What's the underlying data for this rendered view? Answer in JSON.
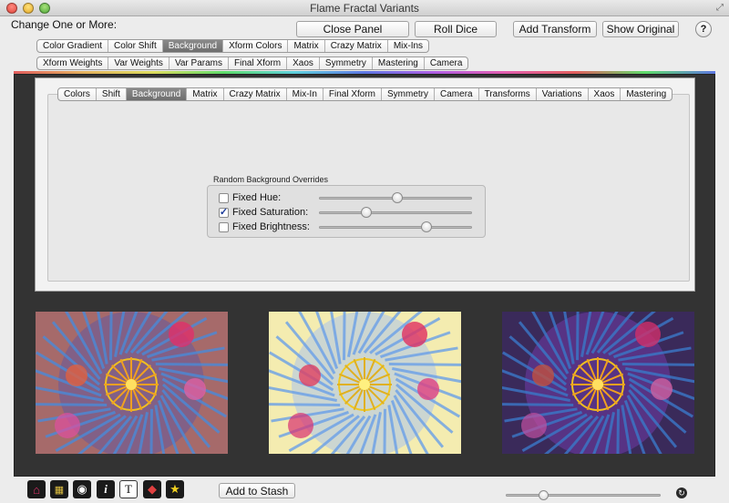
{
  "window": {
    "title": "Flame Fractal Variants"
  },
  "change_label": "Change One or More:",
  "buttons": {
    "close_panel": "Close Panel",
    "roll_dice": "Roll Dice",
    "add_transform": "Add Transform",
    "show_original": "Show Original",
    "help": "?",
    "add_to_stash": "Add to Stash"
  },
  "top_tabs_row1": [
    "Color Gradient",
    "Color Shift",
    "Background",
    "Xform Colors",
    "Matrix",
    "Crazy Matrix",
    "Mix-Ins"
  ],
  "top_tabs_row1_selected": "Background",
  "top_tabs_row2": [
    "Xform Weights",
    "Var Weights",
    "Var Params",
    "Final Xform",
    "Xaos",
    "Symmetry",
    "Mastering",
    "Camera"
  ],
  "inner_tabs": [
    "Colors",
    "Shift",
    "Background",
    "Matrix",
    "Crazy Matrix",
    "Mix-In",
    "Final Xform",
    "Symmetry",
    "Camera",
    "Transforms",
    "Variations",
    "Xaos",
    "Mastering"
  ],
  "inner_tabs_selected": "Background",
  "overrides": {
    "title": "Random Background Overrides",
    "items": [
      {
        "label": "Fixed Hue:",
        "checked": false,
        "slider": 0.51
      },
      {
        "label": "Fixed Saturation:",
        "checked": true,
        "slider": 0.31
      },
      {
        "label": "Fixed Brightness:",
        "checked": false,
        "slider": 0.7
      }
    ]
  },
  "toolbar_icons": [
    "home-icon",
    "palette-grid-icon",
    "eye-icon",
    "info-icon",
    "text-icon",
    "color-wheel-icon",
    "star-icon"
  ],
  "zoom_slider": 0.24,
  "colors": {
    "panel_bg": "#333333",
    "checkmark": "#1a3a9a",
    "selected_tab": "#7a7a7a"
  }
}
